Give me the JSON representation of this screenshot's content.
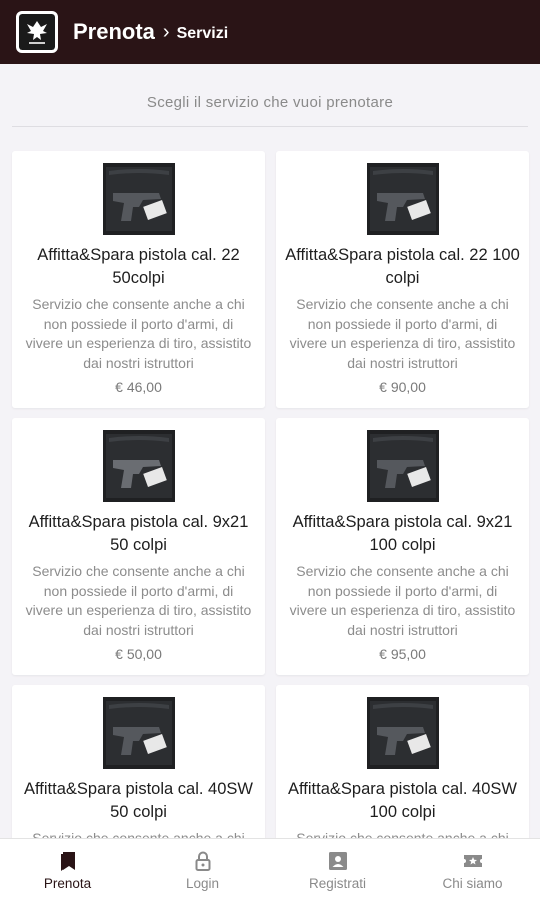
{
  "header": {
    "title": "Prenota",
    "separator": "›",
    "subtitle": "Servizi"
  },
  "page": {
    "instruction": "Scegli il servizio che vuoi prenotare"
  },
  "services": [
    {
      "title": "Affitta&Spara pistola cal. 22 50colpi",
      "description": "Servizio che consente anche a chi non possiede il porto d'armi, di vivere un esperienza di tiro, assistito dai nostri istruttori",
      "price": "€ 46,00"
    },
    {
      "title": "Affitta&Spara pistola cal. 22 100 colpi",
      "description": "Servizio che consente anche a chi non possiede il porto d'armi, di vivere un esperienza di tiro, assistito dai nostri istruttori",
      "price": "€ 90,00"
    },
    {
      "title": "Affitta&Spara pistola cal. 9x21 50 colpi",
      "description": "Servizio che consente anche a chi non possiede il porto d'armi, di vivere un esperienza di tiro, assistito dai nostri istruttori",
      "price": "€ 50,00"
    },
    {
      "title": "Affitta&Spara pistola cal. 9x21 100 colpi",
      "description": "Servizio che consente anche a chi non possiede il porto d'armi, di vivere un esperienza di tiro, assistito dai nostri istruttori",
      "price": "€ 95,00"
    },
    {
      "title": "Affitta&Spara pistola cal. 40SW 50 colpi",
      "description": "Servizio che consente anche a chi non possiede il porto d'armi, di vivere un esperienza di tiro, assistito dai nostri istruttori",
      "price": ""
    },
    {
      "title": "Affitta&Spara pistola cal. 40SW 100 colpi",
      "description": "Servizio che consente anche a chi non possiede il porto d'armi, di vivere un esperienza di tiro, assistito dai nostri istruttori",
      "price": ""
    }
  ],
  "nav": {
    "items": [
      {
        "label": "Prenota",
        "icon": "bookmark-icon",
        "active": true
      },
      {
        "label": "Login",
        "icon": "lock-icon",
        "active": false
      },
      {
        "label": "Registrati",
        "icon": "user-card-icon",
        "active": false
      },
      {
        "label": "Chi siamo",
        "icon": "ticket-star-icon",
        "active": false
      }
    ]
  },
  "colors": {
    "topbar": "#2a1416",
    "background": "#f4f3f7",
    "active_nav": "#2a1416",
    "inactive_nav": "#8a8a8a"
  }
}
